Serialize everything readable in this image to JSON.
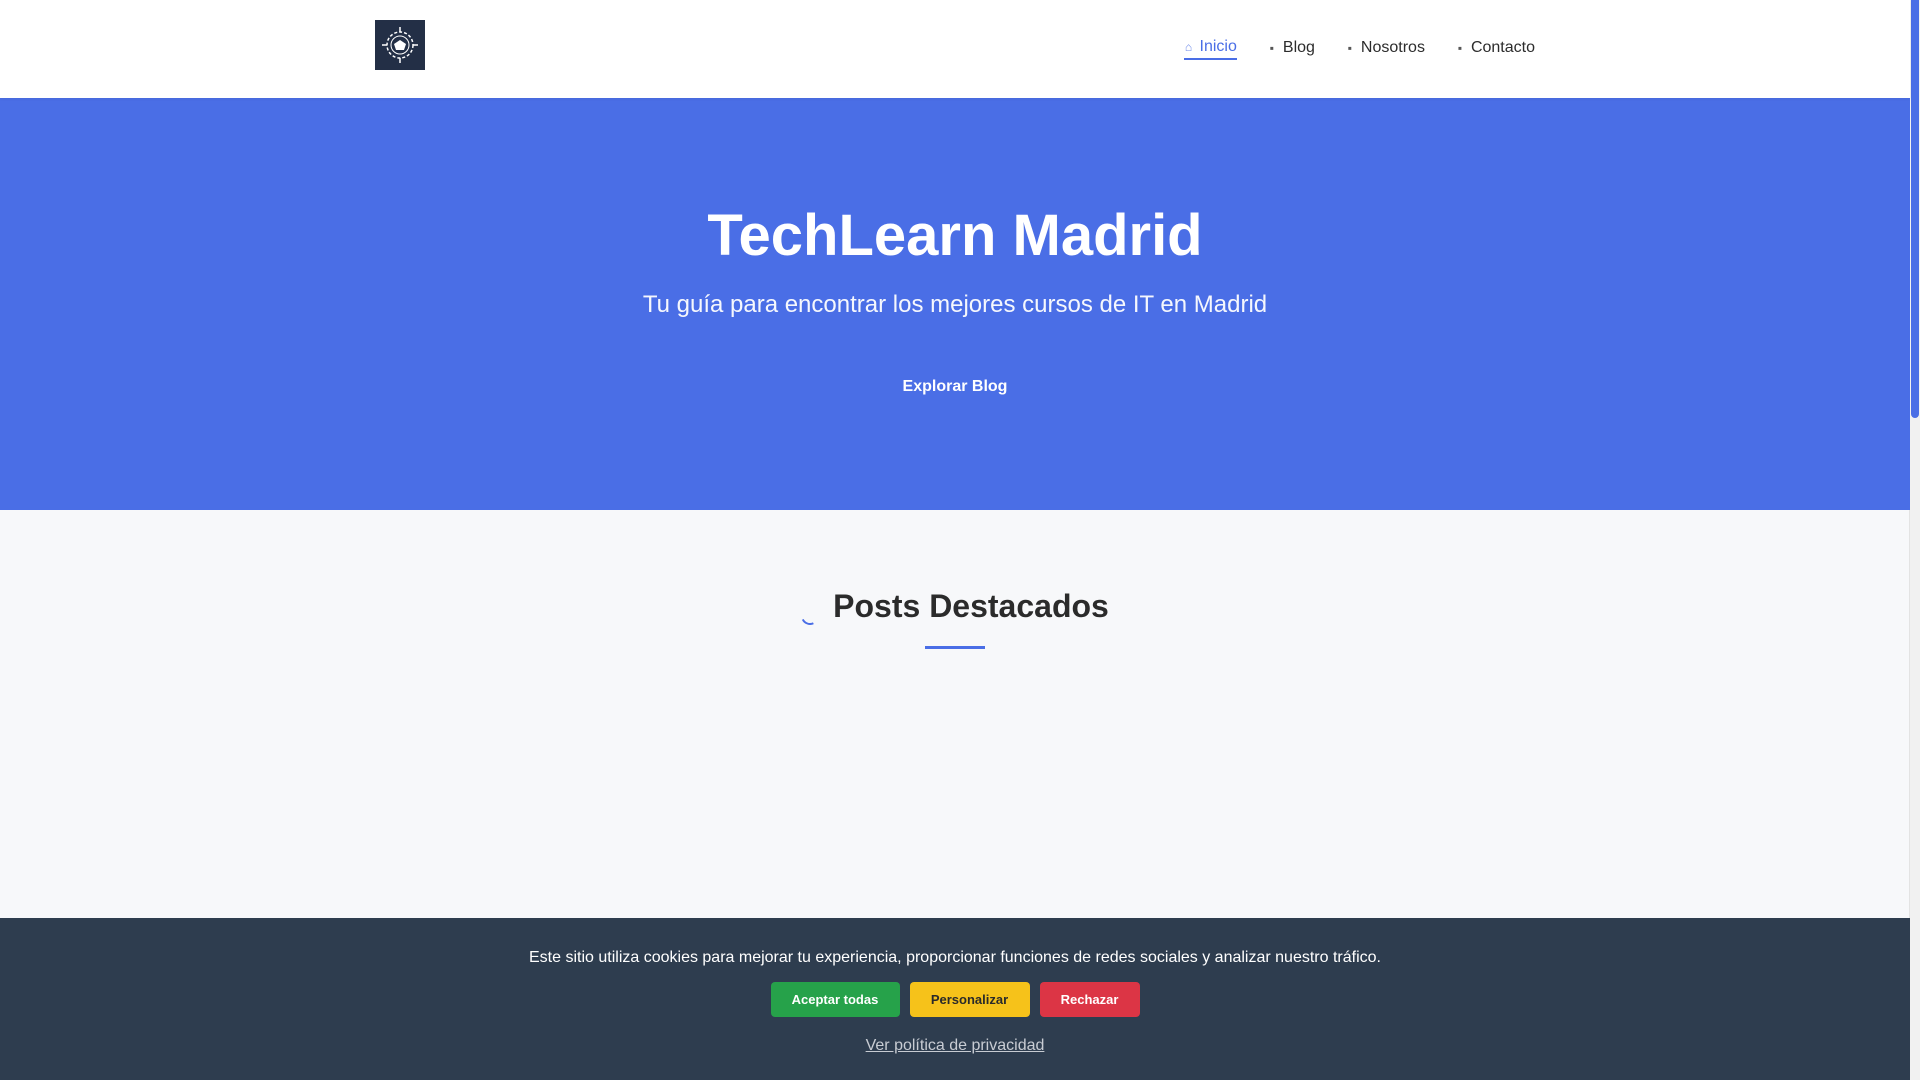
{
  "nav": {
    "items": [
      {
        "label": "Inicio",
        "icon": "home-icon",
        "active": true
      },
      {
        "label": "Blog",
        "icon": "blog-icon",
        "active": false
      },
      {
        "label": "Nosotros",
        "icon": "users-icon",
        "active": false
      },
      {
        "label": "Contacto",
        "icon": "mail-icon",
        "active": false
      }
    ]
  },
  "hero": {
    "title": "TechLearn Madrid",
    "subtitle": "Tu guía para encontrar los mejores cursos de IT en Madrid",
    "button_label": "Explorar Blog"
  },
  "featured": {
    "title": "Posts Destacados"
  },
  "cookies": {
    "text": "Este sitio utiliza cookies para mejorar tu experiencia, proporcionar funciones de redes sociales y analizar nuestro tráfico.",
    "accept_label": "Aceptar todas",
    "customize_label": "Personalizar",
    "reject_label": "Rechazar",
    "privacy_link": "Ver política de privacidad"
  },
  "colors": {
    "primary": "#4a6ee6",
    "banner": "#2e3d4f",
    "accept": "#26a24a",
    "customize": "#f6c21a",
    "reject": "#dc3545"
  }
}
